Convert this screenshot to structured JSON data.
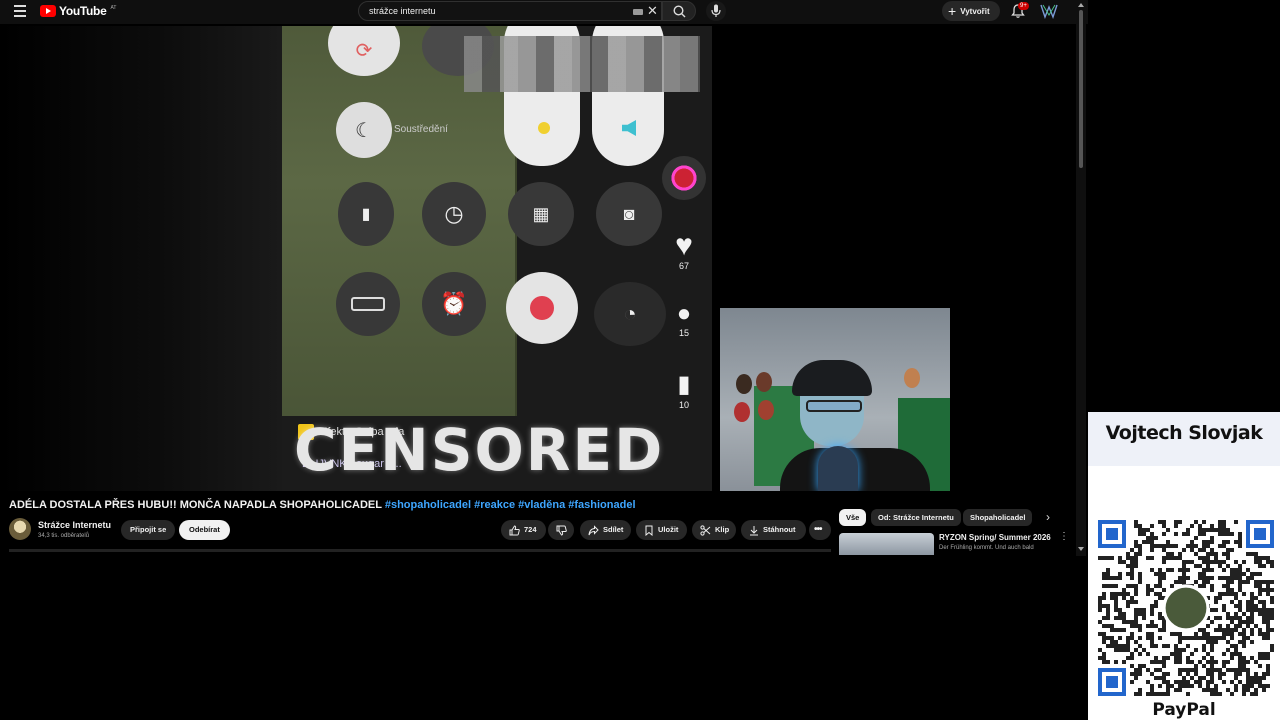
{
  "header": {
    "logo_text": "YouTube",
    "country_code": "AT",
    "search_value": "strážce internetu",
    "create_label": "Vytvořit",
    "notif_badge": "9+"
  },
  "player": {
    "overlay_effect": "Efekt - Culpa mia",
    "overlay_text": "CENSORED",
    "overlay_small": "BLIJVNKA   sugar s...",
    "overlay_dnd": "Soustředění",
    "side_likes": "67",
    "side_comments": "15",
    "side_saves": "10"
  },
  "video": {
    "title_main": "ADÉLA DOSTALA PŘES HUBU!! MONČA NAPADLA SHOPAHOLICADEL ",
    "title_tags": "#shopaholicadel #reakce #vladěna #fashionadel",
    "channel_name": "Strážce Internetu",
    "channel_subs": "34,3 tis. odběratelů",
    "join_label": "Připojit se",
    "subscribe_label": "Odebírat",
    "likes": "724",
    "share_label": "Sdílet",
    "save_label": "Uložit",
    "clip_label": "Klip",
    "download_label": "Stáhnout"
  },
  "chips": [
    "Vše",
    "Od: Strážce Internetu",
    "Shopaholicadel"
  ],
  "recommended": {
    "title": "RYZON Spring/ Summer 2026",
    "subtitle": "Der Frühling kommt. Und auch bald"
  },
  "donation": {
    "name": "Vojtech Slovjak",
    "payment": "PayPal"
  },
  "colors": {
    "accent": "#ff0000",
    "link": "#3ea6ff",
    "background": "#0f0f0f"
  }
}
